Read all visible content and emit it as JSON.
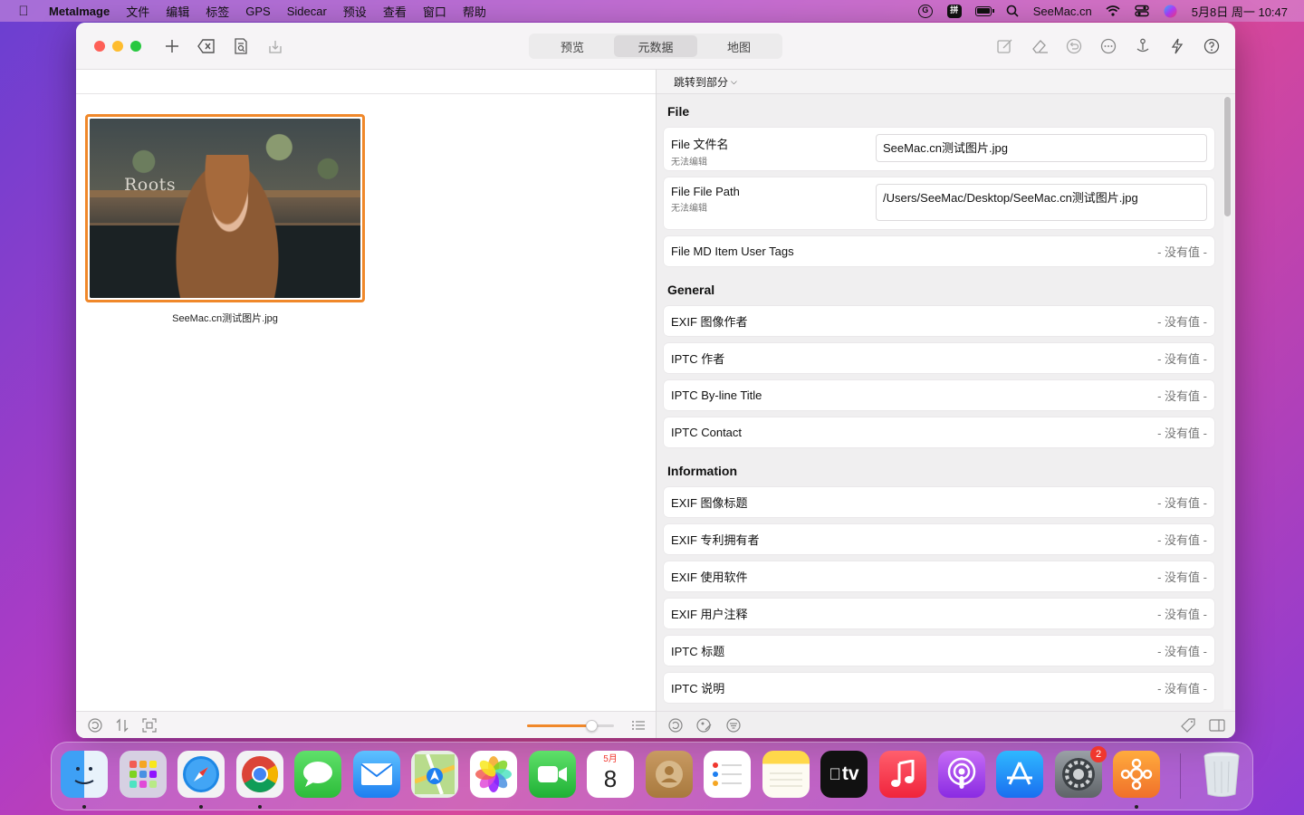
{
  "menubar": {
    "app_name": "MetaImage",
    "items": [
      "文件",
      "编辑",
      "标签",
      "GPS",
      "Sidecar",
      "预设",
      "查看",
      "窗口",
      "帮助"
    ],
    "right_text": "SeeMac.cn",
    "datetime": "5月8日 周一 10:47"
  },
  "toolbar": {
    "tabs": [
      {
        "label": "预览",
        "active": false
      },
      {
        "label": "元数据",
        "active": true
      },
      {
        "label": "地图",
        "active": false
      }
    ]
  },
  "left": {
    "photo_overlay_text": "Roots",
    "thumb_caption": "SeeMac.cn测试图片.jpg",
    "zoom_fraction": 0.75
  },
  "right": {
    "jump_label": "跳转到部分",
    "sections": {
      "file": {
        "title": "File",
        "filename_label": "File 文件名",
        "filename_sub": "无法编辑",
        "filename_value": "SeeMac.cn测试图片.jpg",
        "path_label": "File File Path",
        "path_sub": "无法编辑",
        "path_value": "/Users/SeeMac/Desktop/SeeMac.cn测试图片.jpg",
        "tags_label": "File MD Item User Tags",
        "tags_value": "- 没有值 -"
      },
      "general": {
        "title": "General",
        "rows": [
          {
            "label": "EXIF 图像作者",
            "value": "- 没有值 -"
          },
          {
            "label": "IPTC 作者",
            "value": "- 没有值 -"
          },
          {
            "label": "IPTC By-line Title",
            "value": "- 没有值 -"
          },
          {
            "label": "IPTC Contact",
            "value": "- 没有值 -"
          }
        ]
      },
      "information": {
        "title": "Information",
        "rows": [
          {
            "label": "EXIF 图像标题",
            "value": "- 没有值 -"
          },
          {
            "label": "EXIF 专利拥有者",
            "value": "- 没有值 -"
          },
          {
            "label": "EXIF 使用软件",
            "value": "- 没有值 -"
          },
          {
            "label": "EXIF 用户注释",
            "value": "- 没有值 -"
          },
          {
            "label": "IPTC 标题",
            "value": "- 没有值 -"
          },
          {
            "label": "IPTC 说明",
            "value": "- 没有值 -"
          }
        ]
      }
    }
  },
  "dock": {
    "calendar_month": "5月",
    "calendar_day": "8",
    "settings_badge": "2",
    "apple_tv_label": "tv"
  },
  "colors": {
    "accent": "#f0882a",
    "close": "#fe5f57",
    "minimize": "#febc2e",
    "zoom": "#28c840"
  }
}
